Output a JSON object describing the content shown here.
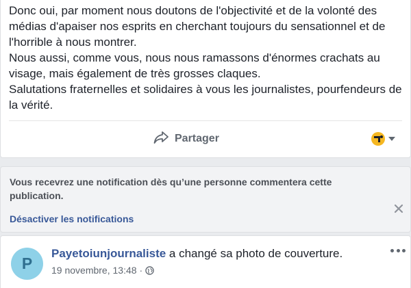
{
  "post": {
    "paragraphs": [
      "Donc oui, par moment nous doutons de l'objectivité et de la volonté des médias d'apaiser nos esprits en cherchant toujours du sensationnel et de l'horrible à nous montrer.",
      "Nous aussi, comme vous, nous nous ramassons d'énormes crachats au visage, mais également de très grosses claques.",
      "Salutations fraternelles et solidaires à vous les journalistes, pourfendeurs de la vérité."
    ],
    "share_label": "Partager",
    "share_icon": "share-arrow-icon",
    "reaction_icon": "page-avatar-icon"
  },
  "notification": {
    "message": "Vous recevrez une notification dès qu’une personne commentera cette publication.",
    "disable_label": "Désactiver les notifications",
    "close_icon": "close-icon"
  },
  "story": {
    "avatar_letter": "P",
    "author": "Payetoiunjournaliste",
    "action": " a changé sa photo de couverture.",
    "timestamp": "19 novembre, 13:48",
    "separator": " · ",
    "privacy_icon": "globe-icon",
    "more_icon": "more-options-icon"
  },
  "colors": {
    "link_blue": "#385898",
    "background": "#e9ebee",
    "avatar_bg": "#8ed1e8",
    "reaction_bg": "#f5b721"
  }
}
